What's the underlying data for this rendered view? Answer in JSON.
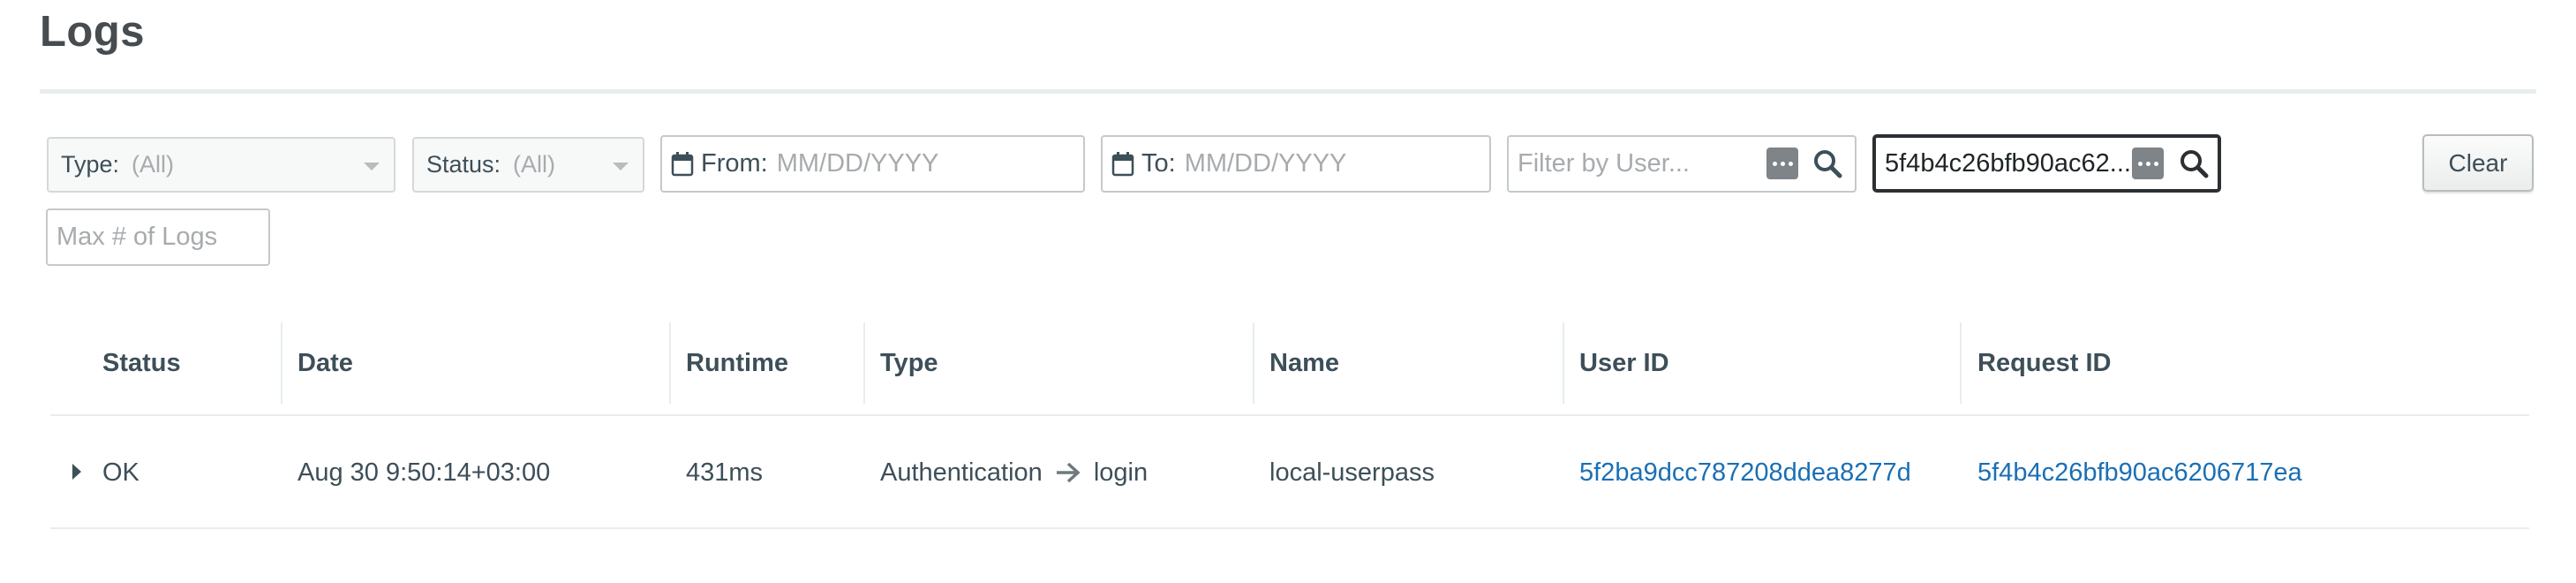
{
  "page": {
    "title": "Logs"
  },
  "filters": {
    "type": {
      "label": "Type:",
      "value": "(All)"
    },
    "status": {
      "label": "Status:",
      "value": "(All)"
    },
    "from_date": {
      "prefix": "From:",
      "placeholder": "MM/DD/YYYY"
    },
    "to_date": {
      "prefix": "To:",
      "placeholder": "MM/DD/YYYY"
    },
    "user": {
      "placeholder": "Filter by User..."
    },
    "request": {
      "value": "5f4b4c26bfb90ac62..."
    },
    "max_logs": {
      "placeholder": "Max # of Logs"
    },
    "clear_label": "Clear"
  },
  "table": {
    "headers": [
      "Status",
      "Date",
      "Runtime",
      "Type",
      "Name",
      "User ID",
      "Request ID"
    ],
    "rows": [
      {
        "status": "OK",
        "date": "Aug 30 9:50:14+03:00",
        "runtime": "431ms",
        "type_main": "Authentication",
        "type_sub": "login",
        "name": "local-userpass",
        "user_id": "5f2ba9dcc787208ddea8277d",
        "request_id": "5f4b4c26bfb90ac6206717ea"
      }
    ]
  },
  "colors": {
    "text": "#3d4f58",
    "link": "#1a6fb5",
    "placeholder": "#a7abae",
    "divider": "#e7eeec",
    "focus_border": "#2c3033"
  },
  "icons": {
    "calendar": "calendar-icon",
    "search": "search-icon",
    "more": "more-dots-icon",
    "expand": "caret-right-icon",
    "arrow": "arrow-right-icon"
  }
}
